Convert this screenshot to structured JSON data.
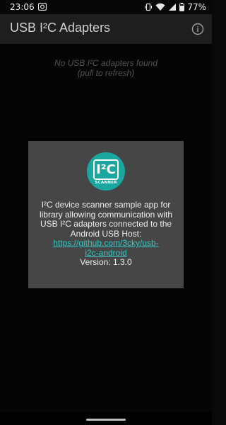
{
  "status": {
    "time": "23:06",
    "battery": "77%"
  },
  "app_bar": {
    "title": "USB I²C Adapters",
    "info_icon": "info-icon"
  },
  "empty_state": {
    "line1": "No USB I²C adapters found",
    "line2": "(pull to refresh)"
  },
  "dialog": {
    "logo": {
      "main": "I²C",
      "sub": "SCANNER",
      "color": "#1aa79f"
    },
    "description": "I²C device scanner sample app for library allowing communication with USB I²C adapters connected to the Android USB Host:",
    "link": "https://github.com/3cky/usb-i2c-android",
    "version": "Version: 1.3.0"
  },
  "colors": {
    "background": "#090909",
    "app_bar": "#1e1e1e",
    "dialog": "#464646",
    "link": "#37c6c2"
  }
}
